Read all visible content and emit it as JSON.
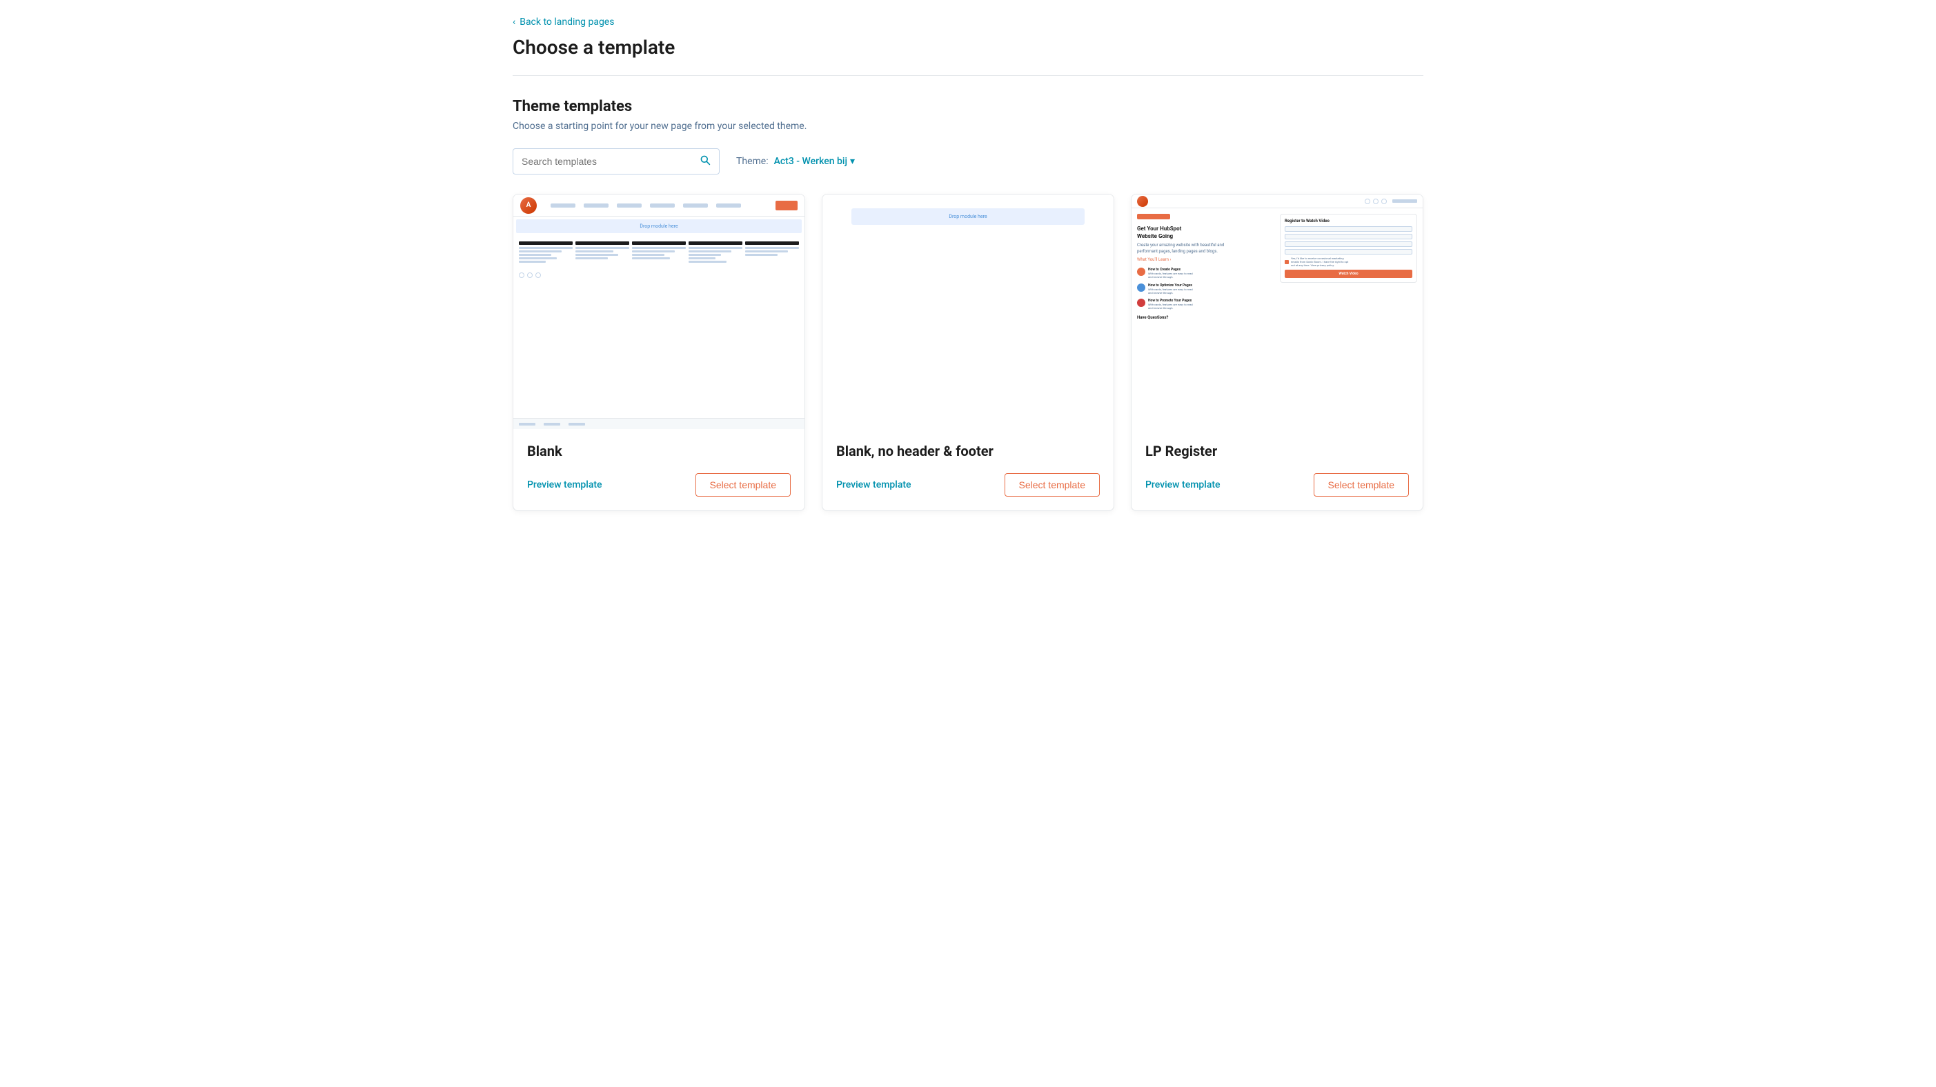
{
  "nav": {
    "back_label": "Back to landing pages"
  },
  "header": {
    "title": "Choose a template"
  },
  "section": {
    "title": "Theme templates",
    "subtitle": "Choose a starting point for your new page from your selected theme."
  },
  "search": {
    "placeholder": "Search templates"
  },
  "theme": {
    "label": "Theme:",
    "selected": "Act3 - Werken bij",
    "dropdown_icon": "▾"
  },
  "templates": [
    {
      "id": "blank",
      "name": "Blank",
      "preview_label": "Preview template",
      "select_label": "Select template",
      "type": "blank"
    },
    {
      "id": "blank-no-header-footer",
      "name": "Blank, no header & footer",
      "preview_label": "Preview template",
      "select_label": "Select template",
      "type": "blank-simple"
    },
    {
      "id": "lp-register",
      "name": "LP Register",
      "preview_label": "Preview template",
      "select_label": "Select template",
      "type": "lp-register"
    }
  ],
  "colors": {
    "accent": "#e86c44",
    "link": "#0091ae"
  }
}
